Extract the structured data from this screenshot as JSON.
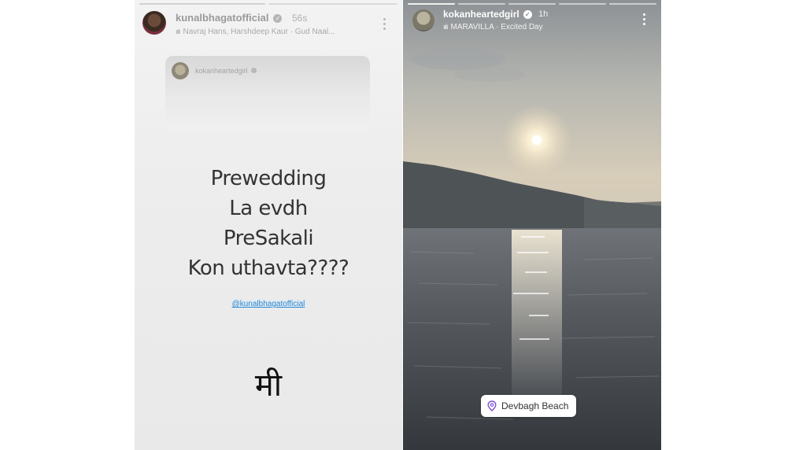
{
  "left_story": {
    "username": "kunalbhagatofficial",
    "time_ago": "56s",
    "music": "Navraj Hans, Harshdeep Kaur · Gud Naal...",
    "shared_post": {
      "username": "kokanheartedgirl"
    },
    "text_lines": [
      "Prewedding",
      "La evdh",
      "PreSakali",
      "Kon uthavta????"
    ],
    "mention": "@kunalbhagatofficial",
    "caption_marathi": "मी"
  },
  "right_story": {
    "username": "kokanheartedgirl",
    "time_ago": "1h",
    "music": "MARAVILLA · Excited Day",
    "location": "Devbagh Beach",
    "location_icon": "map-pin-icon"
  },
  "colors": {
    "mention": "#2f86c9",
    "location_pin": "#7b4fd6"
  }
}
